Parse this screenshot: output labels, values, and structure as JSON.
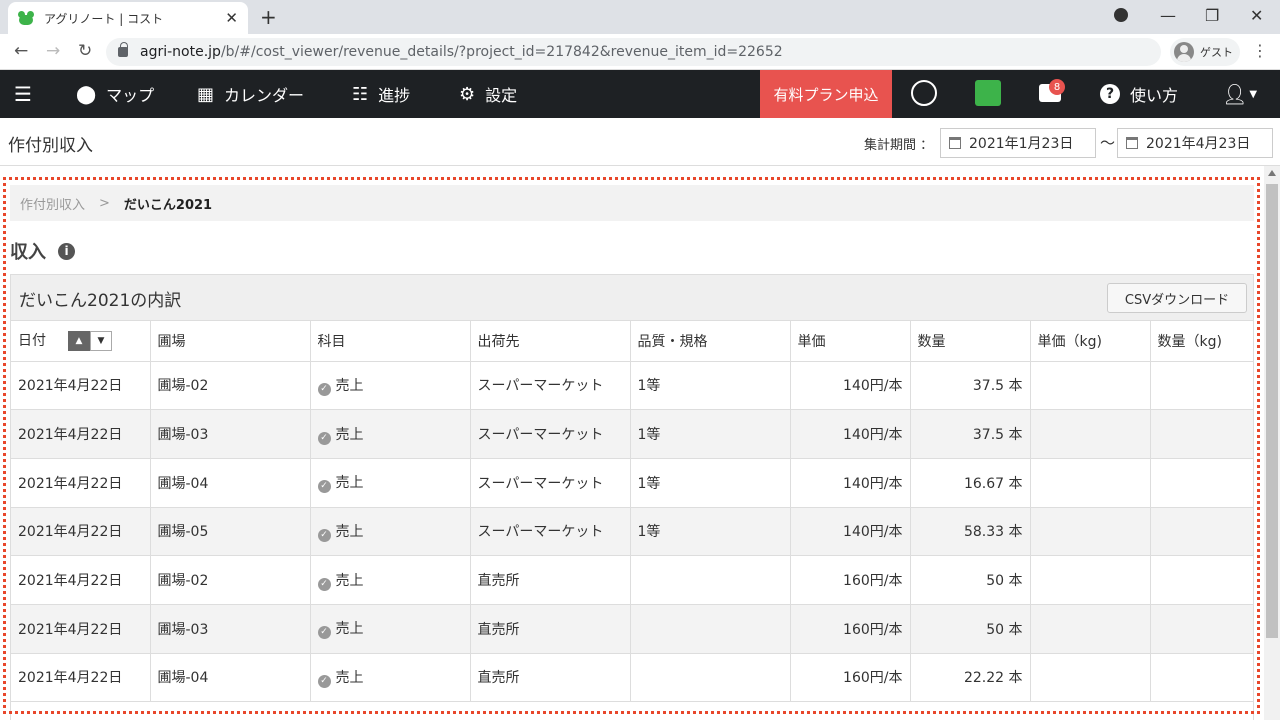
{
  "browser": {
    "tab_title": "アグリノート | コスト",
    "url_host": "agri-note.jp",
    "url_rest": "/b/#/cost_viewer/revenue_details/?project_id=217842&revenue_item_id=22652",
    "profile_label": "ゲスト"
  },
  "nav": {
    "map": "マップ",
    "calendar": "カレンダー",
    "progress": "進捗",
    "settings": "設定",
    "plan": "有料プラン申込",
    "notifications_count": "8",
    "help": "使い方"
  },
  "subheader": {
    "title": "作付別収入",
    "period_label": "集計期間 ：",
    "start_date": "2021年1月23日",
    "end_date": "2021年4月23日",
    "tilde": "〜"
  },
  "breadcrumb": {
    "parent": "作付別収入",
    "separator": ">",
    "current": "だいこん2021"
  },
  "section": {
    "title": "収入"
  },
  "panel": {
    "title": "だいこん2021の内訳",
    "csv_button": "CSVダウンロード"
  },
  "table": {
    "columns": [
      "日付",
      "圃場",
      "科目",
      "出荷先",
      "品質・規格",
      "単価",
      "数量",
      "単価（kg)",
      "数量（kg)"
    ],
    "rows": [
      {
        "date": "2021年4月22日",
        "field": "圃場-02",
        "item": "売上",
        "dest": "スーパーマーケット",
        "grade": "1等",
        "price": "140円/本",
        "qty": "37.5 本",
        "price_kg": "",
        "qty_kg": ""
      },
      {
        "date": "2021年4月22日",
        "field": "圃場-03",
        "item": "売上",
        "dest": "スーパーマーケット",
        "grade": "1等",
        "price": "140円/本",
        "qty": "37.5 本",
        "price_kg": "",
        "qty_kg": ""
      },
      {
        "date": "2021年4月22日",
        "field": "圃場-04",
        "item": "売上",
        "dest": "スーパーマーケット",
        "grade": "1等",
        "price": "140円/本",
        "qty": "16.67 本",
        "price_kg": "",
        "qty_kg": ""
      },
      {
        "date": "2021年4月22日",
        "field": "圃場-05",
        "item": "売上",
        "dest": "スーパーマーケット",
        "grade": "1等",
        "price": "140円/本",
        "qty": "58.33 本",
        "price_kg": "",
        "qty_kg": ""
      },
      {
        "date": "2021年4月22日",
        "field": "圃場-02",
        "item": "売上",
        "dest": "直売所",
        "grade": "",
        "price": "160円/本",
        "qty": "50 本",
        "price_kg": "",
        "qty_kg": ""
      },
      {
        "date": "2021年4月22日",
        "field": "圃場-03",
        "item": "売上",
        "dest": "直売所",
        "grade": "",
        "price": "160円/本",
        "qty": "50 本",
        "price_kg": "",
        "qty_kg": ""
      },
      {
        "date": "2021年4月22日",
        "field": "圃場-04",
        "item": "売上",
        "dest": "直売所",
        "grade": "",
        "price": "160円/本",
        "qty": "22.22 本",
        "price_kg": "",
        "qty_kg": ""
      }
    ]
  },
  "colors": {
    "accent": "#e8534f",
    "nav_bg": "#1e2124",
    "highlight_frame": "#e8472b"
  }
}
